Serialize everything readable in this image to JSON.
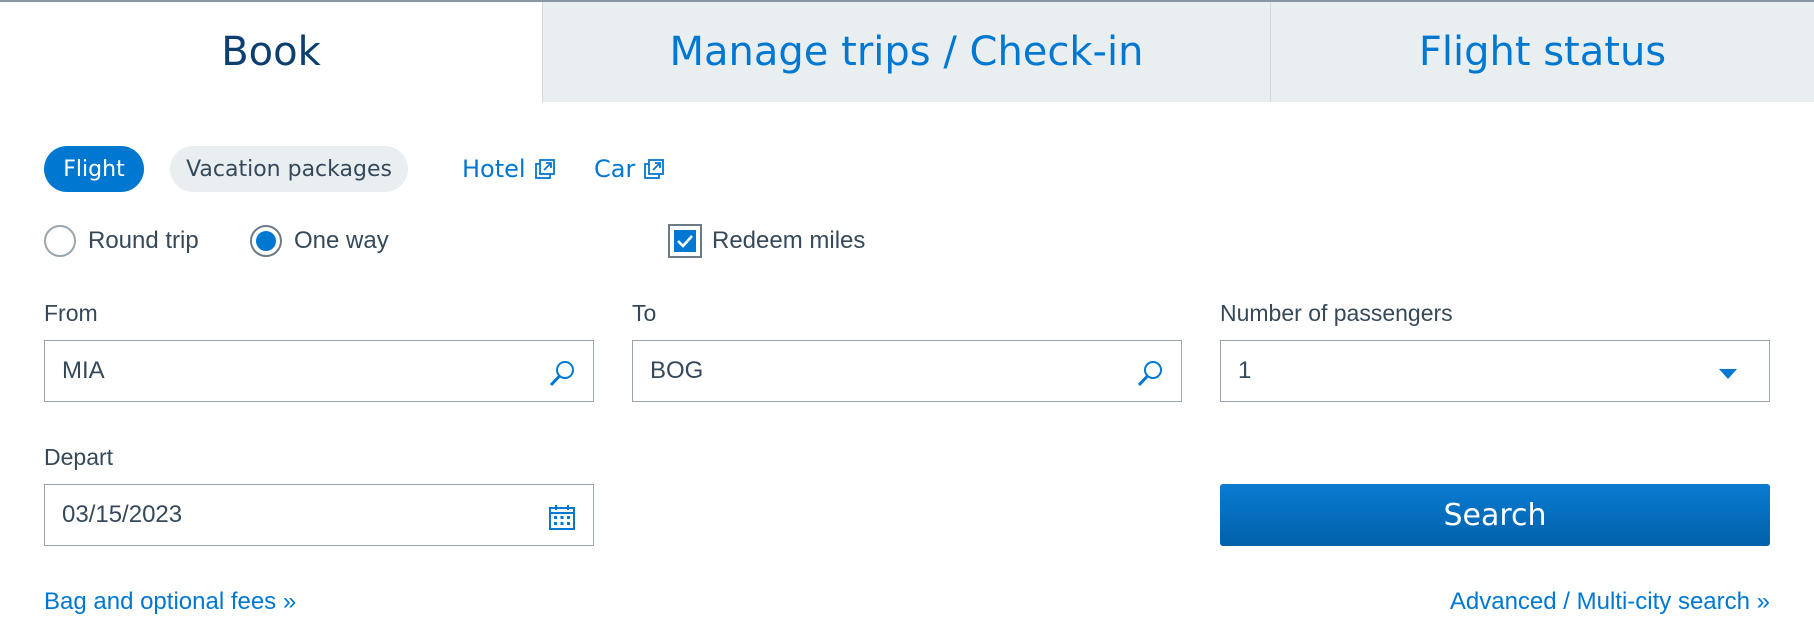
{
  "tabs": [
    {
      "label": "Book",
      "active": true
    },
    {
      "label": "Manage trips / Check-in",
      "active": false
    },
    {
      "label": "Flight status",
      "active": false
    }
  ],
  "booking_types": {
    "flight": "Flight",
    "vacation": "Vacation packages",
    "hotel": "Hotel",
    "car": "Car"
  },
  "trip_type": {
    "round_trip": "Round trip",
    "one_way": "One way",
    "selected": "one_way"
  },
  "redeem_miles": {
    "label": "Redeem miles",
    "checked": true
  },
  "from": {
    "label": "From",
    "value": "MIA"
  },
  "to": {
    "label": "To",
    "value": "BOG"
  },
  "passengers": {
    "label": "Number of passengers",
    "value": "1"
  },
  "depart": {
    "label": "Depart",
    "value": "03/15/2023"
  },
  "search_button": "Search",
  "links": {
    "bag_fees": "Bag and optional fees »",
    "advanced": "Advanced / Multi-city search »"
  },
  "colors": {
    "accent": "#0078d2",
    "active_tab_text": "#0b3f6f",
    "inactive_tab_bg": "#e9eef0",
    "text": "#36495a"
  },
  "icons": {
    "external_link": "external-link-icon",
    "search": "search-icon",
    "calendar": "calendar-icon",
    "dropdown": "caret-down-icon"
  }
}
